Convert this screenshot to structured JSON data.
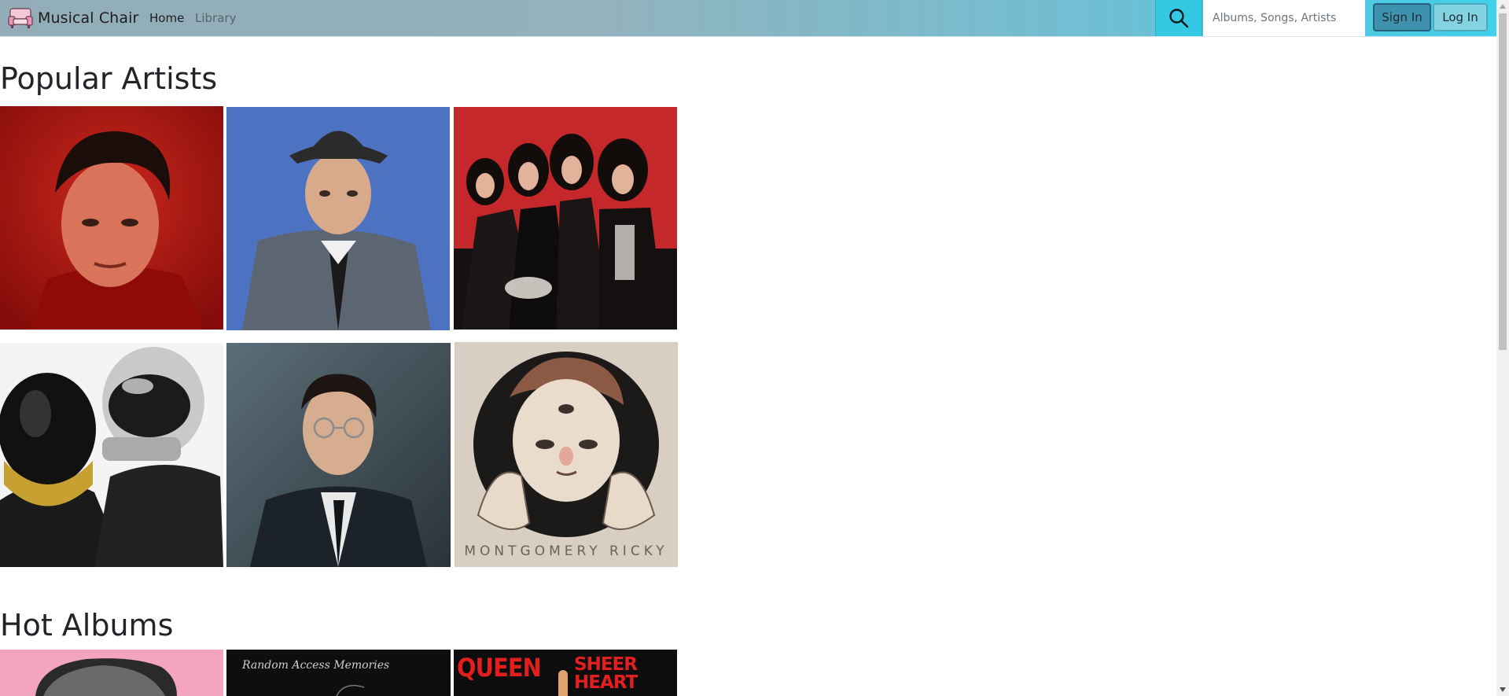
{
  "navbar": {
    "brand": "Musical Chair",
    "links": [
      {
        "label": "Home"
      },
      {
        "label": "Library"
      }
    ],
    "search": {
      "placeholder": "Albums, Songs, Artists",
      "value": ""
    },
    "sign_in_label": "Sign In",
    "log_in_label": "Log In"
  },
  "sections": {
    "artists_title": "Popular Artists",
    "albums_title": "Hot Albums"
  },
  "artists": [
    {
      "icon": "elvis-portrait"
    },
    {
      "icon": "crooner-fedora-portrait"
    },
    {
      "icon": "rock-band-group-photo"
    },
    {
      "icon": "helmeted-duo-photo"
    },
    {
      "icon": "man-in-suit-portrait"
    },
    {
      "icon": "illustrated-face-artwork",
      "caption": "MONTGOMERY RICKY"
    }
  ],
  "albums": [
    {
      "icon": "pink-album-cover"
    },
    {
      "icon": "black-handwritten-album-cover",
      "script": "Random Access Memories"
    },
    {
      "icon": "queen-sheer-heart-album-cover",
      "title_left": "QUEEN",
      "title_right": "SHEER HEART"
    }
  ],
  "colors": {
    "navbar_gradient_start": "#92adb8",
    "navbar_gradient_end": "#3fd0ec",
    "search_button": "#34c8e2",
    "sign_in_button": "#3f92ae",
    "log_in_button": "#84d3e2",
    "queen_red": "#e11f1f"
  }
}
